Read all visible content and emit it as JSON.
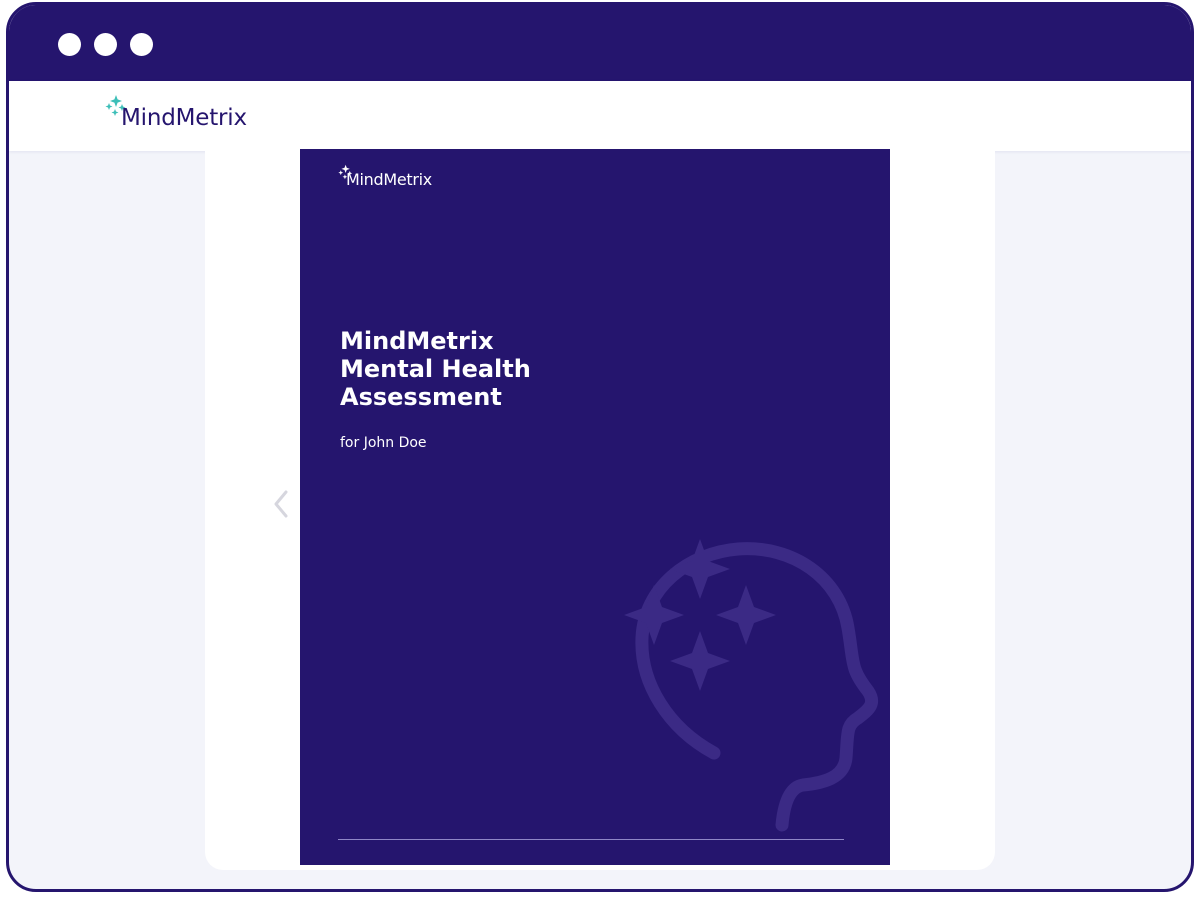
{
  "window": {
    "dots": [
      "window-dot",
      "window-dot",
      "window-dot"
    ]
  },
  "header": {
    "brand": "MindMetrix",
    "logo_icon": "sparkles-icon"
  },
  "viewer": {
    "prev_icon": "chevron-left-icon",
    "page": {
      "brand": "MindMetrix",
      "title_lines": [
        "MindMetrix",
        "Mental Health",
        "Assessment"
      ],
      "subtitle": "for John Doe",
      "illustration_icon": "head-sparkles-icon"
    }
  },
  "colors": {
    "brand": "#25156e",
    "accent": "#3dbfb8",
    "background": "#f3f4fa"
  }
}
